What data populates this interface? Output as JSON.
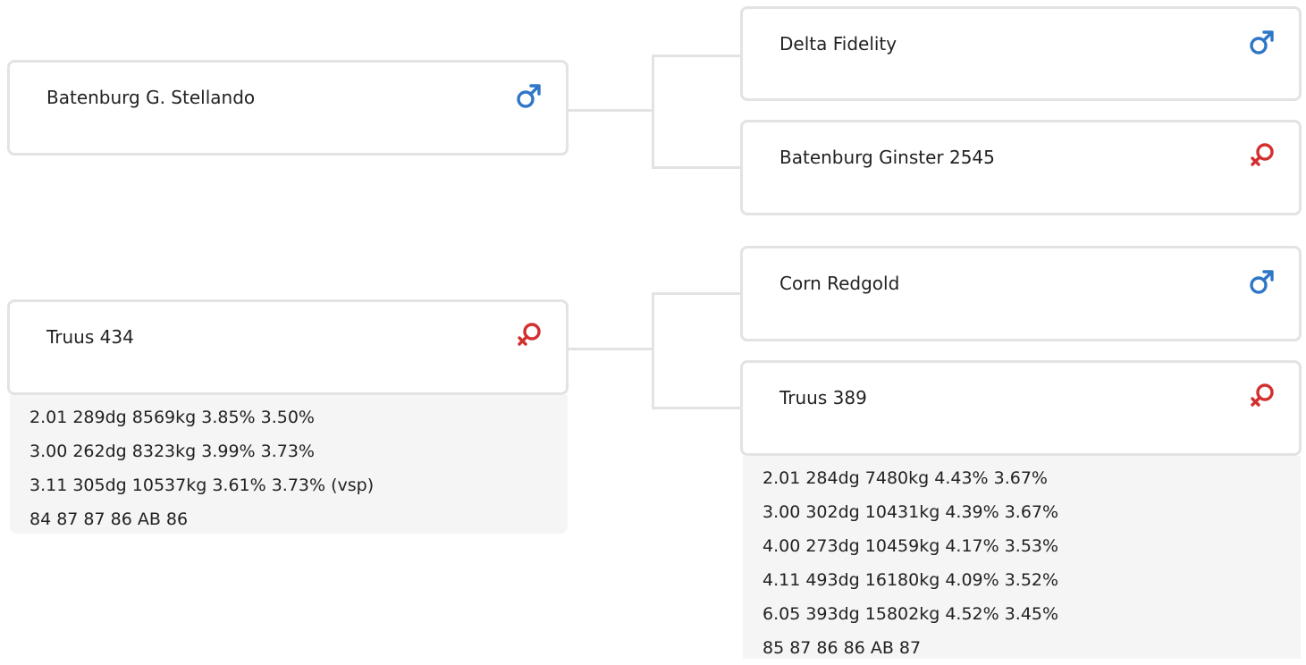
{
  "pedigree": {
    "sire": {
      "name": "Batenburg G. Stellando",
      "sex": "male",
      "sex_icon": "male-symbol-icon",
      "parents": {
        "sire": {
          "name": "Delta Fidelity",
          "sex": "male",
          "sex_icon": "male-symbol-icon"
        },
        "dam": {
          "name": "Batenburg Ginster 2545",
          "sex": "female",
          "sex_icon": "female-symbol-icon"
        }
      }
    },
    "dam": {
      "name": "Truus 434",
      "sex": "female",
      "sex_icon": "female-symbol-icon",
      "stats": [
        "2.01 289dg 8569kg 3.85% 3.50%",
        "3.00 262dg 8323kg 3.99% 3.73%",
        "3.11 305dg 10537kg 3.61% 3.73% (vsp)",
        "84 87 87 86 AB 86"
      ],
      "parents": {
        "sire": {
          "name": "Corn Redgold",
          "sex": "male",
          "sex_icon": "male-symbol-icon"
        },
        "dam": {
          "name": "Truus 389",
          "sex": "female",
          "sex_icon": "female-symbol-icon",
          "stats": [
            "2.01 284dg 7480kg 4.43% 3.67%",
            "3.00 302dg 10431kg 4.39% 3.67%",
            "4.00 273dg 10459kg 4.17% 3.53%",
            "4.11 493dg 16180kg 4.09% 3.52%",
            "6.05 393dg 15802kg 4.52% 3.45%",
            "85 87 86 86 AB 87"
          ]
        }
      }
    }
  },
  "colors": {
    "male": "#2f76c7",
    "female": "#d32f2f",
    "card_border": "#e3e3e3",
    "stats_background": "#f5f5f5"
  }
}
